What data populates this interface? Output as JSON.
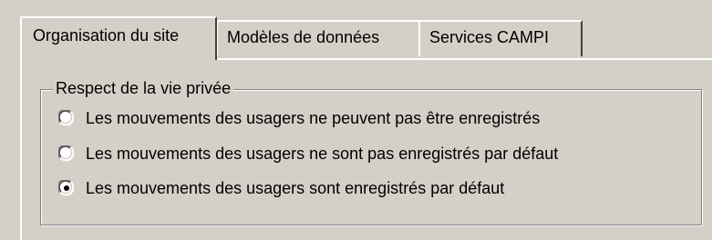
{
  "tabs": [
    {
      "label": "Organisation du site",
      "active": true
    },
    {
      "label": "Modèles de données",
      "active": false
    },
    {
      "label": "Services CAMPI",
      "active": false
    }
  ],
  "privacy_group": {
    "title": "Respect de la vie privée",
    "options": [
      {
        "label": "Les mouvements des usagers ne peuvent pas être enregistrés",
        "selected": false
      },
      {
        "label": "Les mouvements des usagers ne sont pas enregistrés par défaut",
        "selected": false
      },
      {
        "label": "Les mouvements des usagers sont enregistrés par défaut",
        "selected": true
      }
    ]
  },
  "colors": {
    "face": "#d4d0c8",
    "highlight": "#ffffff",
    "shadow": "#808080",
    "dark_shadow": "#404040"
  }
}
